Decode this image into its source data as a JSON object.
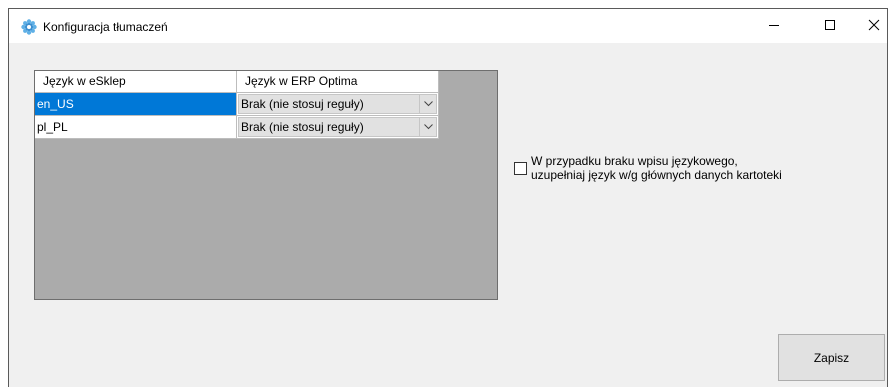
{
  "window": {
    "title": "Konfiguracja tłumaczeń",
    "icon": "gear-icon",
    "controls": {
      "minimize_icon": "minimize-icon",
      "maximize_icon": "maximize-icon",
      "close_icon": "close-icon"
    }
  },
  "grid": {
    "columns": [
      "Język w eSklep",
      "Język w ERP Optima"
    ],
    "rows": [
      {
        "language": "en_US",
        "erp_language": "Brak (nie stosuj reguły)",
        "selected": true
      },
      {
        "language": "pl_PL",
        "erp_language": "Brak (nie stosuj reguły)",
        "selected": false
      }
    ]
  },
  "option": {
    "checked": false,
    "label_line1": "W przypadku braku wpisu językowego,",
    "label_line2": "uzupełniaj język w/g głównych danych kartoteki"
  },
  "actions": {
    "save_label": "Zapisz"
  },
  "colors": {
    "selection": "#0078d7",
    "grid_background": "#ababab",
    "window_background": "#f0f0f0"
  }
}
